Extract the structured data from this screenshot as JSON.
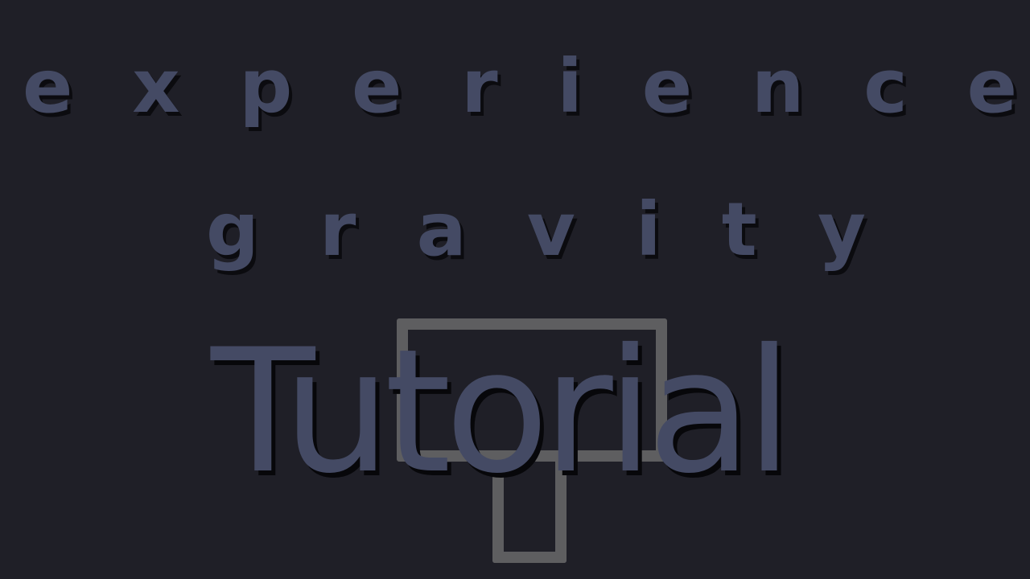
{
  "title": {
    "line1": [
      "e",
      "x",
      "p",
      "e",
      "r",
      "i",
      "e",
      "n",
      "c",
      "e"
    ],
    "line2": [
      "g",
      "r",
      "a",
      "v",
      "i",
      "t",
      "y"
    ]
  },
  "screen": {
    "heading": "Tutorial"
  },
  "colors": {
    "background": "#1f1f27",
    "text": "#444a64",
    "outline": "#5e5e60",
    "shadow": "#0b0b0f"
  }
}
